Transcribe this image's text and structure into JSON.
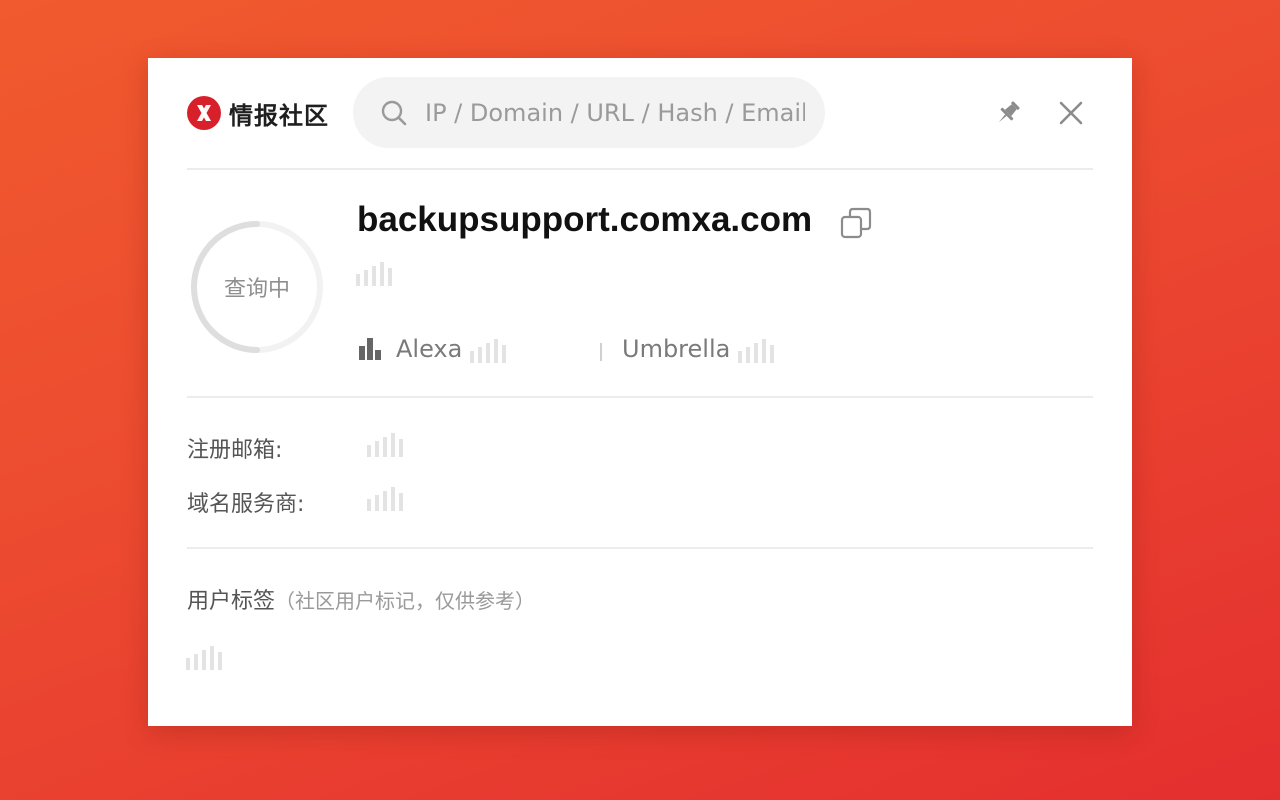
{
  "header": {
    "brand_text": "情报社区",
    "search_placeholder": "IP / Domain / URL / Hash / Email"
  },
  "status": {
    "spinner_text": "查询中"
  },
  "domain": {
    "name": "backupsupport.comxa.com"
  },
  "ranks": [
    {
      "label": "Alexa"
    },
    {
      "label": "Umbrella"
    }
  ],
  "whois": {
    "email_label": "注册邮箱:",
    "registrar_label": "域名服务商:"
  },
  "tags": {
    "title": "用户标签",
    "note": "（社区用户标记，仅供参考）"
  },
  "colors": {
    "accent": "#d8202a",
    "background_top": "#f05a2e",
    "background_bottom": "#e42f2f",
    "loading_bars": "#e3e3e3",
    "icon_gray": "#8c8c8c"
  },
  "icons": {
    "logo": "x-logo-icon",
    "search": "search-icon",
    "pin": "pin-icon",
    "close": "close-icon",
    "copy": "copy-icon",
    "rank": "bar-chart-icon",
    "loading": "loading-bars-icon"
  }
}
